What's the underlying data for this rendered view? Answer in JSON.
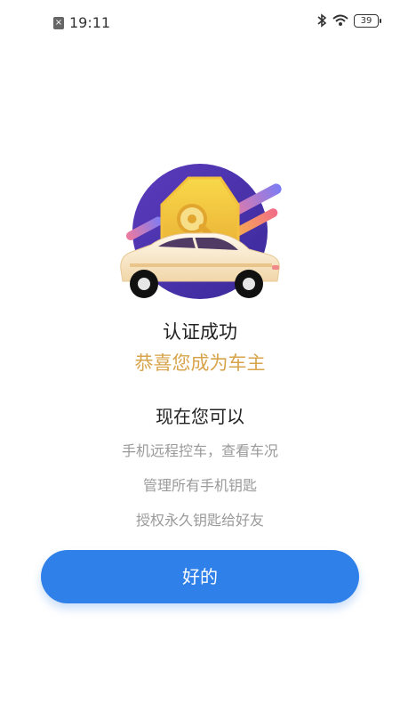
{
  "status_bar": {
    "time": "19:11",
    "battery_level": "39",
    "icons": [
      "notification-icon",
      "bluetooth-icon",
      "wifi-icon",
      "battery-icon"
    ]
  },
  "illustration": {
    "icons": [
      "key-icon",
      "car-icon"
    ]
  },
  "texts": {
    "success": "认证成功",
    "congrats": "恭喜您成为车主",
    "now_can": "现在您可以",
    "features": [
      "手机远程控车，查看车况",
      "管理所有手机钥匙",
      "授权永久钥匙给好友"
    ]
  },
  "button": {
    "ok_label": "好的"
  },
  "colors": {
    "accent": "#2f80e9",
    "gold": "#d8a44b",
    "muted": "#9a9a9a"
  }
}
